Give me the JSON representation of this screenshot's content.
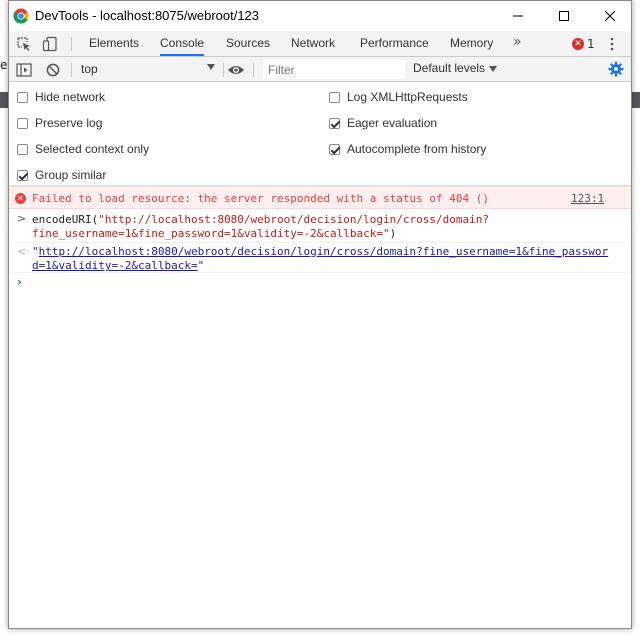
{
  "window": {
    "title": "DevTools - localhost:8075/webroot/123"
  },
  "background": {
    "partial_char": "e"
  },
  "tabs": [
    {
      "label": "Elements",
      "active": false
    },
    {
      "label": "Console",
      "active": true
    },
    {
      "label": "Sources",
      "active": false
    },
    {
      "label": "Network",
      "active": false
    },
    {
      "label": "Performance",
      "active": false
    },
    {
      "label": "Memory",
      "active": false
    }
  ],
  "tabbar": {
    "more_label": "»",
    "error_count": "1",
    "accent_color": "#1a73e8",
    "error_color": "#d93025"
  },
  "console_toolbar": {
    "context": "top",
    "filter_placeholder": "Filter",
    "filter_value": "",
    "levels": "Default levels"
  },
  "settings": {
    "left": [
      {
        "label": "Hide network",
        "checked": false
      },
      {
        "label": "Preserve log",
        "checked": false
      },
      {
        "label": "Selected context only",
        "checked": false
      },
      {
        "label": "Group similar",
        "checked": true
      }
    ],
    "right": [
      {
        "label": "Log XMLHttpRequests",
        "checked": false
      },
      {
        "label": "Eager evaluation",
        "checked": true
      },
      {
        "label": "Autocomplete from history",
        "checked": true
      }
    ]
  },
  "messages": {
    "error": {
      "text": "Failed to load resource: the server responded with a status of 404 ()",
      "source": "123:1"
    },
    "input": {
      "func": "encodeURI(",
      "arg_part1": "\"http://localhost:8080/webroot/decision/login/cross/domain?",
      "arg_part2": "fine_username=1&fine_password=1&validity=-2&callback=\"",
      "close": ")"
    },
    "result": {
      "quote_open": "\"",
      "line1": "http://localhost:8080/webroot/decision/login/cross/domain?fine_username=1&fine_passwor",
      "line2": "d=1&validity=-2&callback=",
      "quote_close": "\""
    }
  }
}
